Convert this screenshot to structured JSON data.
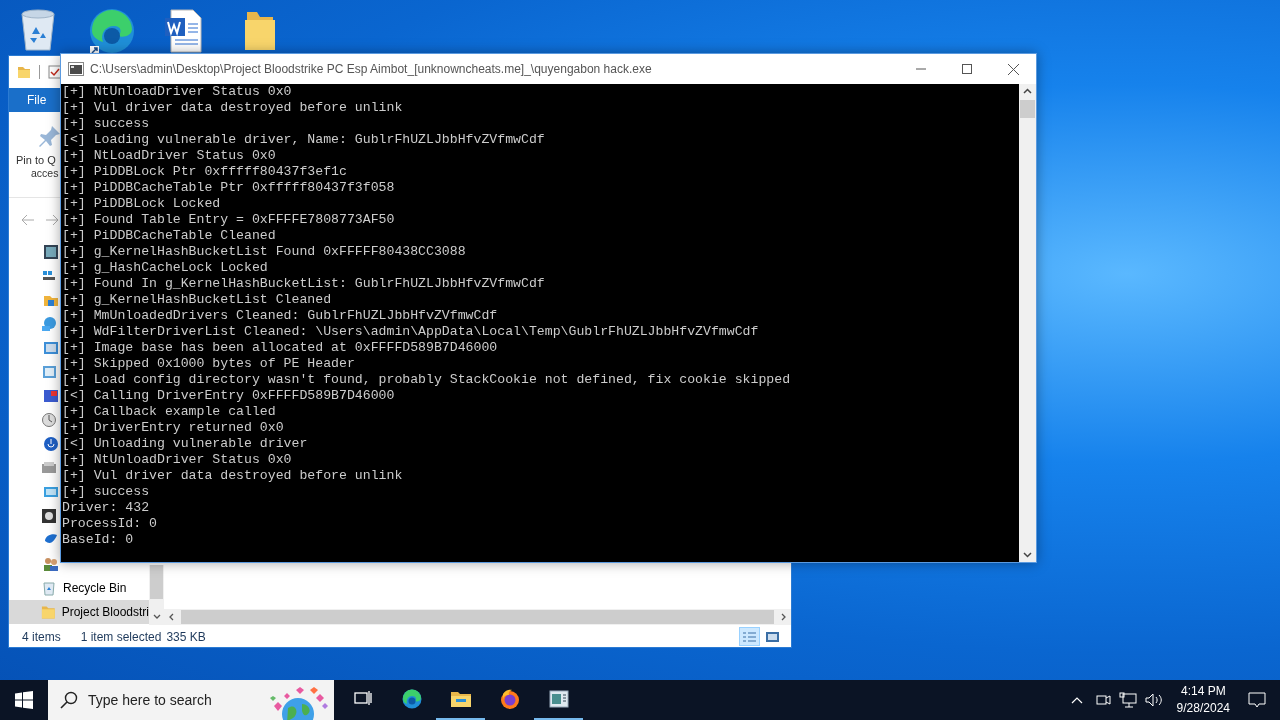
{
  "desktop_icons": [
    {
      "kind": "recycle-bin"
    },
    {
      "kind": "edge"
    },
    {
      "kind": "word-document"
    },
    {
      "kind": "folder"
    }
  ],
  "explorer": {
    "ribbon_tab": "File",
    "pin_label": [
      "Pin to Q",
      "acces"
    ],
    "nav_items": [
      {
        "label": "Recycle Bin",
        "kind": "recycle-bin",
        "selected": false
      },
      {
        "label": "Project Bloodstri",
        "kind": "folder",
        "selected": true
      }
    ],
    "status_bar": {
      "item_count": "4 items",
      "selection": "1 item selected",
      "size": "335 KB"
    },
    "views": [
      {
        "kind": "details",
        "selected": true
      },
      {
        "kind": "large-icons",
        "selected": false
      }
    ]
  },
  "console": {
    "title": "C:\\Users\\admin\\Desktop\\Project Bloodstrike PC Esp Aimbot_[unknowncheats.me]_\\quyengabon hack.exe",
    "lines": [
      "[+] NtUnloadDriver Status 0x0",
      "[+] Vul driver data destroyed before unlink",
      "[+] success",
      "[<] Loading vulnerable driver, Name: GublrFhUZLJbbHfvZVfmwCdf",
      "[+] NtLoadDriver Status 0x0",
      "[+] PiDDBLock Ptr 0xfffff80437f3ef1c",
      "[+] PiDDBCacheTable Ptr 0xfffff80437f3f058",
      "[+] PiDDBLock Locked",
      "[+] Found Table Entry = 0xFFFFE7808773AF50",
      "[+] PiDDBCacheTable Cleaned",
      "[+] g_KernelHashBucketList Found 0xFFFFF80438CC3088",
      "[+] g_HashCacheLock Locked",
      "[+] Found In g_KernelHashBucketList: GublrFhUZLJbbHfvZVfmwCdf",
      "[+] g_KernelHashBucketList Cleaned",
      "[+] MmUnloadedDrivers Cleaned: GublrFhUZLJbbHfvZVfmwCdf",
      "[+] WdFilterDriverList Cleaned: \\Users\\admin\\AppData\\Local\\Temp\\GublrFhUZLJbbHfvZVfmwCdf",
      "[+] Image base has been allocated at 0xFFFFD589B7D46000",
      "[+] Skipped 0x1000 bytes of PE Header",
      "[+] Load config directory wasn't found, probably StackCookie not defined, fix cookie skipped",
      "[<] Calling DriverEntry 0xFFFFD589B7D46000",
      "[+] Callback example called",
      "[+] DriverEntry returned 0x0",
      "[<] Unloading vulnerable driver",
      "[+] NtUnloadDriver Status 0x0",
      "[+] Vul driver data destroyed before unlink",
      "[+] success",
      "Driver: 432",
      "ProcessId: 0",
      "BaseId: 0"
    ]
  },
  "taskbar": {
    "search_placeholder": "Type here to search",
    "apps": [
      {
        "kind": "task-view",
        "active": false
      },
      {
        "kind": "edge",
        "active": false
      },
      {
        "kind": "file-explorer",
        "active": true
      },
      {
        "kind": "firefox",
        "active": false
      },
      {
        "kind": "console",
        "active": true
      }
    ],
    "time": "4:14 PM",
    "date": "9/28/2024"
  }
}
